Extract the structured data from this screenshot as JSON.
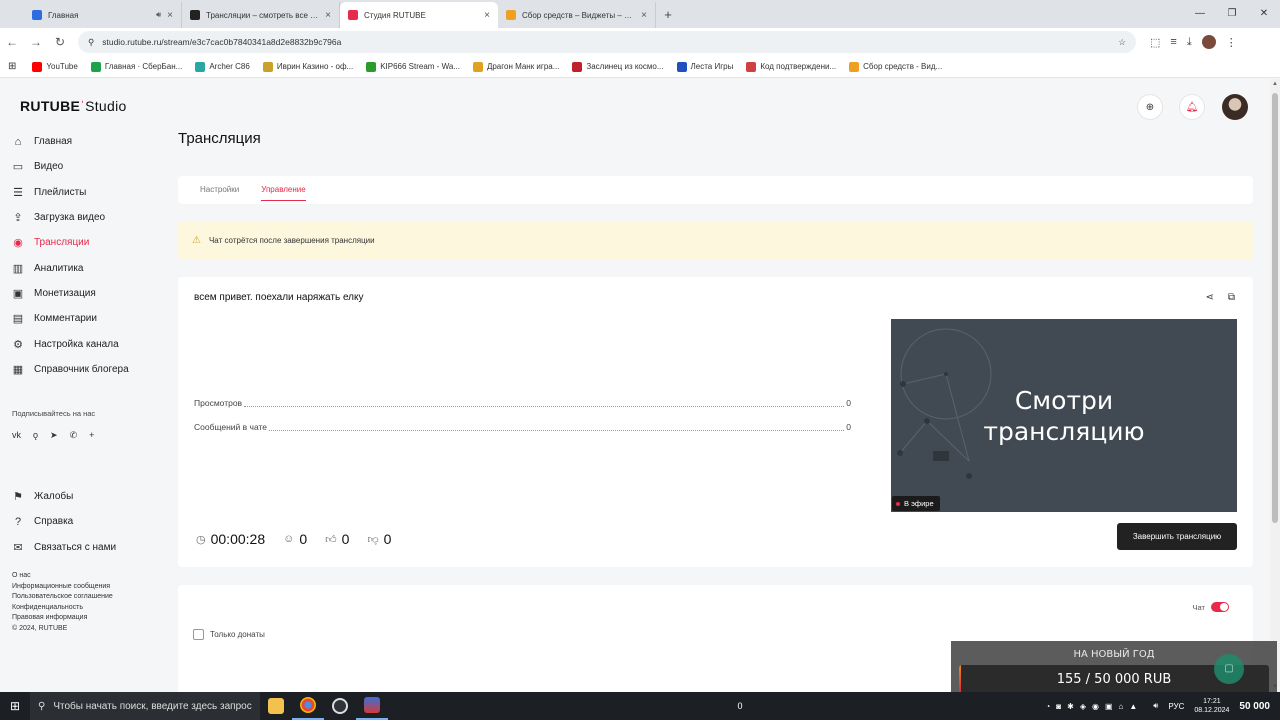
{
  "browser": {
    "tabs": [
      {
        "title": "Главная",
        "color": "#2d6cdf",
        "active": false,
        "has_sound": true
      },
      {
        "title": "Трансляции – смотреть все ви...",
        "color": "#222222",
        "active": false,
        "has_sound": false
      },
      {
        "title": "Студия RUTUBE",
        "color": "#e8294a",
        "active": true,
        "has_sound": false
      },
      {
        "title": "Сбор средств – Виджеты – Пан...",
        "color": "#f0a020",
        "active": false,
        "has_sound": false
      }
    ],
    "url": "studio.rutube.ru/stream/e3c7cac0b7840341a8d2e8832b9c796a",
    "bookmarks": [
      {
        "label": "YouTube",
        "color": "#ff0000"
      },
      {
        "label": "Главная · СберБан...",
        "color": "#1fa34a"
      },
      {
        "label": "Archer C86",
        "color": "#2aa7a0"
      },
      {
        "label": "Иврин Казино - оф...",
        "color": "#c7a12a"
      },
      {
        "label": "KIP666 Stream - Wa...",
        "color": "#2b9b2b"
      },
      {
        "label": "Драгон Манк игра...",
        "color": "#e0a020"
      },
      {
        "label": "Заслинец из космо...",
        "color": "#c0202a"
      },
      {
        "label": "Леста Игры",
        "color": "#2050c0"
      },
      {
        "label": "Код подтверждени...",
        "color": "#d04040"
      },
      {
        "label": "Сбор средств - Вид...",
        "color": "#f0a020"
      }
    ]
  },
  "app": {
    "logo_main": "RUTUBE",
    "logo_studio": "Studio",
    "nav": [
      {
        "label": "Главная",
        "icon": "home-icon",
        "glyph": "⌂",
        "active": false
      },
      {
        "label": "Видео",
        "icon": "video-icon",
        "glyph": "▭",
        "active": false
      },
      {
        "label": "Плейлисты",
        "icon": "playlist-icon",
        "glyph": "☰",
        "active": false
      },
      {
        "label": "Загрузка видео",
        "icon": "upload-icon",
        "glyph": "⇪",
        "active": false
      },
      {
        "label": "Трансляции",
        "icon": "broadcast-icon",
        "glyph": "◉",
        "active": true
      },
      {
        "label": "Аналитика",
        "icon": "analytics-icon",
        "glyph": "▥",
        "active": false
      },
      {
        "label": "Монетизация",
        "icon": "monetization-icon",
        "glyph": "▣",
        "active": false
      },
      {
        "label": "Комментарии",
        "icon": "comments-icon",
        "glyph": "▤",
        "active": false
      },
      {
        "label": "Настройка канала",
        "icon": "settings-icon",
        "glyph": "⚙",
        "active": false
      },
      {
        "label": "Справочник блогера",
        "icon": "handbook-icon",
        "glyph": "▦",
        "active": false
      }
    ],
    "subscribe_label": "Подписывайтесь на нас",
    "social": [
      "vk",
      "ok",
      "telegram",
      "viber",
      "more"
    ],
    "nav2": [
      {
        "label": "Жалобы",
        "icon": "flag-icon",
        "glyph": "⚑"
      },
      {
        "label": "Справка",
        "icon": "help-icon",
        "glyph": "?"
      },
      {
        "label": "Связаться с нами",
        "icon": "mail-icon",
        "glyph": "✉"
      }
    ],
    "footer_links": [
      "О нас",
      "Информационные сообщения",
      "Пользовательское соглашение",
      "Конфиденциальность",
      "Правовая информация",
      "© 2024, RUTUBE"
    ]
  },
  "page": {
    "title": "Трансляция",
    "tabs": [
      {
        "label": "Настройки",
        "active": false
      },
      {
        "label": "Управление",
        "active": true
      }
    ],
    "warning": "Чат сотрётся после завершения трансляции",
    "stream_title": "всем привет. поехали наряжать елку",
    "stats": [
      {
        "label": "Просмотров",
        "value": "0"
      },
      {
        "label": "Сообщений в чате",
        "value": "0"
      }
    ],
    "duration": "00:00:28",
    "viewers": "0",
    "likes": "0",
    "dislikes": "0",
    "preview_line1": "Смотри",
    "preview_line2": "трансляцию",
    "live_badge": "В эфире",
    "end_button": "Завершить трансляцию",
    "chat_label": "Чат",
    "chat_enabled": true,
    "donations_only_label": "Только донаты"
  },
  "overlay": {
    "goal_title": "НА НОВЫЙ ГОД",
    "goal_value": "155 / 50 000 RUB",
    "goal_progress": 0.0031
  },
  "taskbar": {
    "search_placeholder": "Чтобы начать поиск, введите здесь запрос",
    "left_counter": "0",
    "lang": "РУС",
    "time": "17:21",
    "date": "08.12.2024",
    "right_value": "50 000"
  }
}
